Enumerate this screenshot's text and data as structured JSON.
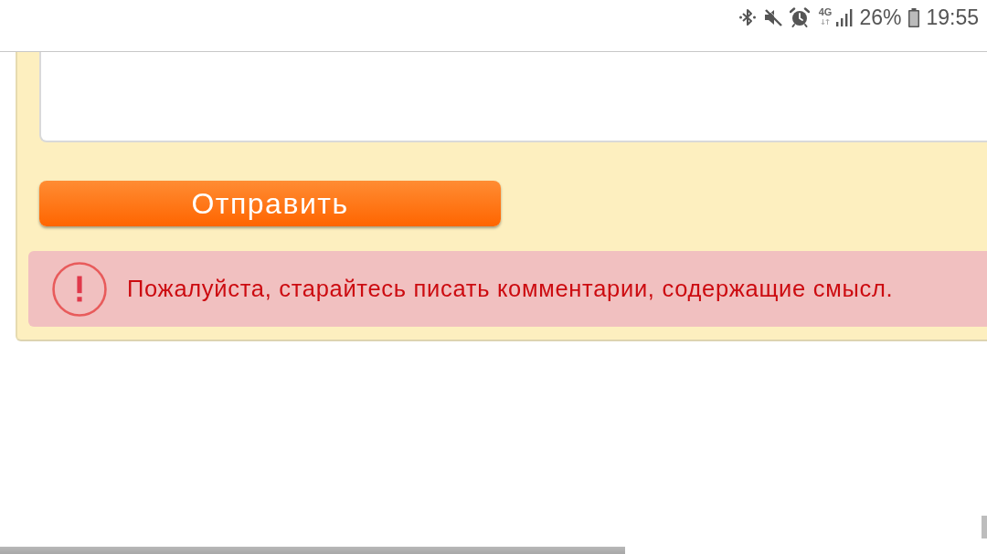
{
  "status_bar": {
    "network": "4G",
    "battery": "26%",
    "time": "19:55"
  },
  "comment_form": {
    "submit_button": {
      "label": "Отправить"
    },
    "alert": {
      "message": "Пожалуйста, старайтесь писать комментарии, содержащие смысл."
    }
  }
}
